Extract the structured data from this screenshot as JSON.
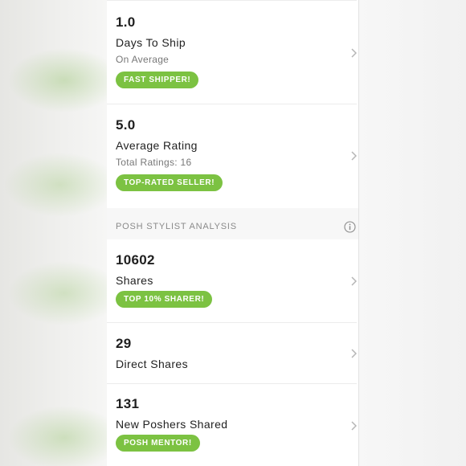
{
  "stats": [
    {
      "value": "1.0",
      "label": "Days To Ship",
      "sub": "On Average",
      "badge": "FAST SHIPPER!"
    },
    {
      "value": "5.0",
      "label": "Average Rating",
      "sub": "Total Ratings: 16",
      "badge": "TOP-RATED SELLER!"
    }
  ],
  "section": {
    "title": "POSH STYLIST ANALYSIS",
    "icon": "info-icon"
  },
  "stylist": [
    {
      "value": "10602",
      "label": "Shares",
      "badge": "TOP 10% SHARER!"
    },
    {
      "value": "29",
      "label": "Direct Shares"
    },
    {
      "value": "131",
      "label": "New Poshers Shared",
      "badge": "POSH MENTOR!"
    }
  ],
  "colors": {
    "badge": "#7cc242",
    "chevron": "#b5b5b5"
  },
  "icons": {
    "row_arrow": "chevron-right-icon"
  }
}
